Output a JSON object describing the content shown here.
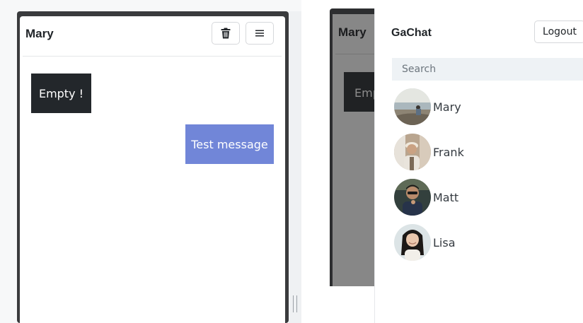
{
  "chat": {
    "title": "Mary",
    "toolbar": {
      "delete_icon": "trash-icon",
      "menu_icon": "hamburger-menu-icon"
    },
    "messages": [
      {
        "direction": "incoming",
        "text": "Empty !"
      },
      {
        "direction": "outgoing",
        "text": "Test message"
      }
    ],
    "colors": {
      "incoming": "#23272b",
      "outgoing": "#7186d8"
    }
  },
  "background_chat": {
    "title": "Mary",
    "message_fragment": "Empty !"
  },
  "drawer": {
    "app_title": "GaChat",
    "logout_label": "Logout",
    "search_placeholder": "Search",
    "contacts": [
      {
        "name": "Mary",
        "avatar": "avatar-photo"
      },
      {
        "name": "Frank",
        "avatar": "avatar-photo"
      },
      {
        "name": "Matt",
        "avatar": "avatar-photo"
      },
      {
        "name": "Lisa",
        "avatar": "avatar-photo"
      }
    ]
  }
}
